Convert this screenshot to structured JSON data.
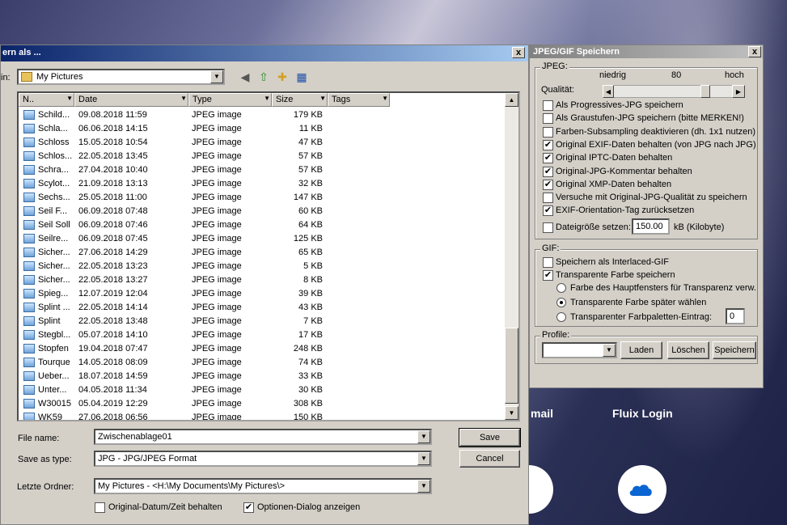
{
  "background": {
    "email_label": "mail",
    "fluix_label": "Fluix Login"
  },
  "dialog": {
    "title": "ern als ...",
    "close": "x",
    "save_in_label": "in:",
    "save_in_value": "My Pictures",
    "columns": [
      "N..",
      "Date",
      "Type",
      "Size",
      "Tags"
    ],
    "files": [
      {
        "name": "Schild...",
        "date": "09.08.2018 11:59",
        "type": "JPEG image",
        "size": "179 KB"
      },
      {
        "name": "Schla...",
        "date": "06.06.2018 14:15",
        "type": "JPEG image",
        "size": "11 KB"
      },
      {
        "name": "Schloss",
        "date": "15.05.2018 10:54",
        "type": "JPEG image",
        "size": "47 KB"
      },
      {
        "name": "Schlos...",
        "date": "22.05.2018 13:45",
        "type": "JPEG image",
        "size": "57 KB"
      },
      {
        "name": "Schra...",
        "date": "27.04.2018 10:40",
        "type": "JPEG image",
        "size": "57 KB"
      },
      {
        "name": "Scylot...",
        "date": "21.09.2018 13:13",
        "type": "JPEG image",
        "size": "32 KB"
      },
      {
        "name": "Sechs...",
        "date": "25.05.2018 11:00",
        "type": "JPEG image",
        "size": "147 KB"
      },
      {
        "name": "Seil F...",
        "date": "06.09.2018 07:48",
        "type": "JPEG image",
        "size": "60 KB"
      },
      {
        "name": "Seil Soll",
        "date": "06.09.2018 07:46",
        "type": "JPEG image",
        "size": "64 KB"
      },
      {
        "name": "Seilre...",
        "date": "06.09.2018 07:45",
        "type": "JPEG image",
        "size": "125 KB"
      },
      {
        "name": "Sicher...",
        "date": "27.06.2018 14:29",
        "type": "JPEG image",
        "size": "65 KB"
      },
      {
        "name": "Sicher...",
        "date": "22.05.2018 13:23",
        "type": "JPEG image",
        "size": "5 KB"
      },
      {
        "name": "Sicher...",
        "date": "22.05.2018 13:27",
        "type": "JPEG image",
        "size": "8 KB"
      },
      {
        "name": "Spieg...",
        "date": "12.07.2019 12:04",
        "type": "JPEG image",
        "size": "39 KB"
      },
      {
        "name": "Splint ...",
        "date": "22.05.2018 14:14",
        "type": "JPEG image",
        "size": "43 KB"
      },
      {
        "name": "Splint",
        "date": "22.05.2018 13:48",
        "type": "JPEG image",
        "size": "7 KB"
      },
      {
        "name": "Stegbl...",
        "date": "05.07.2018 14:10",
        "type": "JPEG image",
        "size": "17 KB"
      },
      {
        "name": "Stopfen",
        "date": "19.04.2018 07:47",
        "type": "JPEG image",
        "size": "248 KB"
      },
      {
        "name": "Tourque",
        "date": "14.05.2018 08:09",
        "type": "JPEG image",
        "size": "74 KB"
      },
      {
        "name": "Ueber...",
        "date": "18.07.2018 14:59",
        "type": "JPEG image",
        "size": "33 KB"
      },
      {
        "name": "Unter...",
        "date": "04.05.2018 11:34",
        "type": "JPEG image",
        "size": "30 KB"
      },
      {
        "name": "W30015",
        "date": "05.04.2019 12:29",
        "type": "JPEG image",
        "size": "308 KB"
      },
      {
        "name": "WK59",
        "date": "27.06.2018 06:56",
        "type": "JPEG image",
        "size": "150 KB"
      }
    ],
    "file_name_label": "File name:",
    "file_name_value": "Zwischenablage01",
    "save_type_label": "Save as type:",
    "save_type_value": "JPG - JPG/JPEG Format",
    "recent_label": "Letzte Ordner:",
    "recent_value": "My Pictures  -  <H:\\My Documents\\My Pictures\\>",
    "save_button": "Save",
    "cancel_button": "Cancel",
    "keep_date_label": "Original-Datum/Zeit behalten",
    "keep_date_checked": false,
    "show_options_label": "Optionen-Dialog anzeigen",
    "show_options_checked": true
  },
  "options": {
    "title": "JPEG/GIF Speichern",
    "close": "x",
    "jpeg_group": "JPEG:",
    "low_label": "niedrig",
    "quality_value": "80",
    "high_label": "hoch",
    "quality_label": "Qualität:",
    "quality_level": 80,
    "jpeg_checks": [
      {
        "label": "Als Progressives-JPG speichern",
        "checked": false
      },
      {
        "label": "Als Graustufen-JPG speichern (bitte MERKEN!)",
        "checked": false
      },
      {
        "label": "Farben-Subsampling deaktivieren (dh. 1x1 nutzen)",
        "checked": false
      },
      {
        "label": "Original EXIF-Daten behalten (von JPG nach JPG)",
        "checked": true
      },
      {
        "label": "Original IPTC-Daten behalten",
        "checked": true
      },
      {
        "label": "Original-JPG-Kommentar behalten",
        "checked": true
      },
      {
        "label": "Original XMP-Daten behalten",
        "checked": true
      },
      {
        "label": "Versuche mit Original-JPG-Qualität zu speichern",
        "checked": false
      },
      {
        "label": "EXIF-Orientation-Tag zurücksetzen",
        "checked": true
      }
    ],
    "filesize_label": "Dateigröße setzen:",
    "filesize_checked": false,
    "filesize_value": "150.00",
    "filesize_unit": "kB (Kilobyte)",
    "gif_group": "GIF:",
    "gif_interlaced": "Speichern als Interlaced-GIF",
    "gif_interlaced_checked": false,
    "gif_transparent": "Transparente Farbe speichern",
    "gif_transparent_checked": true,
    "radio_main": "Farbe des Hauptfensters für Transparenz verw.",
    "radio_later": "Transparente Farbe später wählen",
    "radio_palette": "Transparenter Farbpaletten-Eintrag:",
    "palette_value": "0",
    "profile_group": "Profile:",
    "load_button": "Laden",
    "delete_button": "Löschen",
    "save_button": "Speichern"
  }
}
